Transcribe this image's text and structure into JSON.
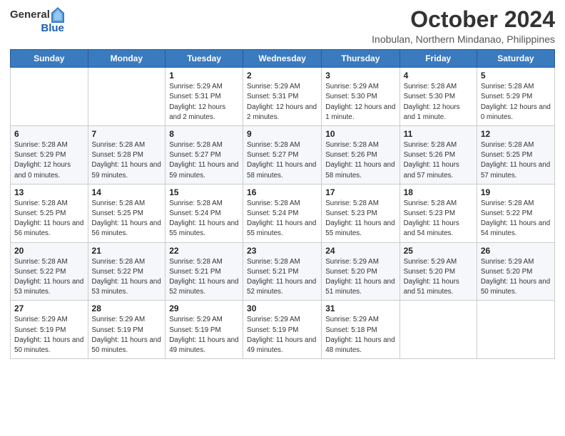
{
  "header": {
    "logo_general": "General",
    "logo_blue": "Blue",
    "month_title": "October 2024",
    "location": "Inobulan, Northern Mindanao, Philippines"
  },
  "days_of_week": [
    "Sunday",
    "Monday",
    "Tuesday",
    "Wednesday",
    "Thursday",
    "Friday",
    "Saturday"
  ],
  "weeks": [
    [
      {
        "day": "",
        "detail": ""
      },
      {
        "day": "",
        "detail": ""
      },
      {
        "day": "1",
        "detail": "Sunrise: 5:29 AM\nSunset: 5:31 PM\nDaylight: 12 hours and 2 minutes."
      },
      {
        "day": "2",
        "detail": "Sunrise: 5:29 AM\nSunset: 5:31 PM\nDaylight: 12 hours and 2 minutes."
      },
      {
        "day": "3",
        "detail": "Sunrise: 5:29 AM\nSunset: 5:30 PM\nDaylight: 12 hours and 1 minute."
      },
      {
        "day": "4",
        "detail": "Sunrise: 5:28 AM\nSunset: 5:30 PM\nDaylight: 12 hours and 1 minute."
      },
      {
        "day": "5",
        "detail": "Sunrise: 5:28 AM\nSunset: 5:29 PM\nDaylight: 12 hours and 0 minutes."
      }
    ],
    [
      {
        "day": "6",
        "detail": "Sunrise: 5:28 AM\nSunset: 5:29 PM\nDaylight: 12 hours and 0 minutes."
      },
      {
        "day": "7",
        "detail": "Sunrise: 5:28 AM\nSunset: 5:28 PM\nDaylight: 11 hours and 59 minutes."
      },
      {
        "day": "8",
        "detail": "Sunrise: 5:28 AM\nSunset: 5:27 PM\nDaylight: 11 hours and 59 minutes."
      },
      {
        "day": "9",
        "detail": "Sunrise: 5:28 AM\nSunset: 5:27 PM\nDaylight: 11 hours and 58 minutes."
      },
      {
        "day": "10",
        "detail": "Sunrise: 5:28 AM\nSunset: 5:26 PM\nDaylight: 11 hours and 58 minutes."
      },
      {
        "day": "11",
        "detail": "Sunrise: 5:28 AM\nSunset: 5:26 PM\nDaylight: 11 hours and 57 minutes."
      },
      {
        "day": "12",
        "detail": "Sunrise: 5:28 AM\nSunset: 5:25 PM\nDaylight: 11 hours and 57 minutes."
      }
    ],
    [
      {
        "day": "13",
        "detail": "Sunrise: 5:28 AM\nSunset: 5:25 PM\nDaylight: 11 hours and 56 minutes."
      },
      {
        "day": "14",
        "detail": "Sunrise: 5:28 AM\nSunset: 5:25 PM\nDaylight: 11 hours and 56 minutes."
      },
      {
        "day": "15",
        "detail": "Sunrise: 5:28 AM\nSunset: 5:24 PM\nDaylight: 11 hours and 55 minutes."
      },
      {
        "day": "16",
        "detail": "Sunrise: 5:28 AM\nSunset: 5:24 PM\nDaylight: 11 hours and 55 minutes."
      },
      {
        "day": "17",
        "detail": "Sunrise: 5:28 AM\nSunset: 5:23 PM\nDaylight: 11 hours and 55 minutes."
      },
      {
        "day": "18",
        "detail": "Sunrise: 5:28 AM\nSunset: 5:23 PM\nDaylight: 11 hours and 54 minutes."
      },
      {
        "day": "19",
        "detail": "Sunrise: 5:28 AM\nSunset: 5:22 PM\nDaylight: 11 hours and 54 minutes."
      }
    ],
    [
      {
        "day": "20",
        "detail": "Sunrise: 5:28 AM\nSunset: 5:22 PM\nDaylight: 11 hours and 53 minutes."
      },
      {
        "day": "21",
        "detail": "Sunrise: 5:28 AM\nSunset: 5:22 PM\nDaylight: 11 hours and 53 minutes."
      },
      {
        "day": "22",
        "detail": "Sunrise: 5:28 AM\nSunset: 5:21 PM\nDaylight: 11 hours and 52 minutes."
      },
      {
        "day": "23",
        "detail": "Sunrise: 5:28 AM\nSunset: 5:21 PM\nDaylight: 11 hours and 52 minutes."
      },
      {
        "day": "24",
        "detail": "Sunrise: 5:29 AM\nSunset: 5:20 PM\nDaylight: 11 hours and 51 minutes."
      },
      {
        "day": "25",
        "detail": "Sunrise: 5:29 AM\nSunset: 5:20 PM\nDaylight: 11 hours and 51 minutes."
      },
      {
        "day": "26",
        "detail": "Sunrise: 5:29 AM\nSunset: 5:20 PM\nDaylight: 11 hours and 50 minutes."
      }
    ],
    [
      {
        "day": "27",
        "detail": "Sunrise: 5:29 AM\nSunset: 5:19 PM\nDaylight: 11 hours and 50 minutes."
      },
      {
        "day": "28",
        "detail": "Sunrise: 5:29 AM\nSunset: 5:19 PM\nDaylight: 11 hours and 50 minutes."
      },
      {
        "day": "29",
        "detail": "Sunrise: 5:29 AM\nSunset: 5:19 PM\nDaylight: 11 hours and 49 minutes."
      },
      {
        "day": "30",
        "detail": "Sunrise: 5:29 AM\nSunset: 5:19 PM\nDaylight: 11 hours and 49 minutes."
      },
      {
        "day": "31",
        "detail": "Sunrise: 5:29 AM\nSunset: 5:18 PM\nDaylight: 11 hours and 48 minutes."
      },
      {
        "day": "",
        "detail": ""
      },
      {
        "day": "",
        "detail": ""
      }
    ]
  ]
}
